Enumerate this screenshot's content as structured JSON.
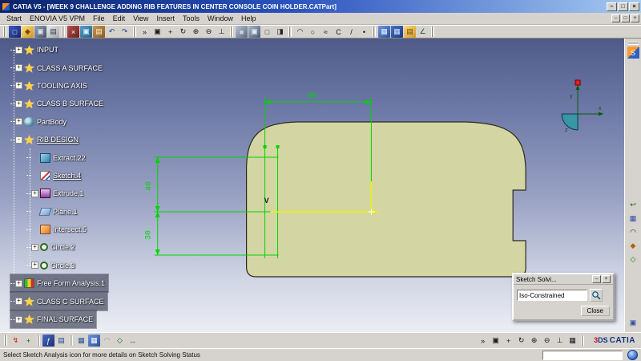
{
  "colors": {
    "titlebar_blue": "#0a246a",
    "viewport_top": "#4f5a88",
    "viewport_bottom": "#eceef5",
    "dim_green": "#00d400",
    "axis_yellow": "#f0f000",
    "surface_fill": "#d3d6a2"
  },
  "window": {
    "title": "CATIA V5 - [WEEK 9 CHALLENGE ADDING RIB FEATURES IN CENTER CONSOLE COIN HOLDER.CATPart]",
    "min": "–",
    "max": "□",
    "close": "×"
  },
  "mdi": {
    "min": "–",
    "restore": "□",
    "close": "×"
  },
  "menubar": {
    "items": [
      {
        "name": "menu-start",
        "label": "Start"
      },
      {
        "name": "menu-enovia",
        "label": "ENOVIA V5 VPM"
      },
      {
        "name": "menu-file",
        "label": "File"
      },
      {
        "name": "menu-edit",
        "label": "Edit"
      },
      {
        "name": "menu-view",
        "label": "View"
      },
      {
        "name": "menu-insert",
        "label": "Insert"
      },
      {
        "name": "menu-tools",
        "label": "Tools"
      },
      {
        "name": "menu-window",
        "label": "Window"
      },
      {
        "name": "menu-help",
        "label": "Help"
      }
    ]
  },
  "toolbar_top": {
    "icons": [
      {
        "cls": "grip"
      },
      {
        "name": "new-document-icon",
        "glyph": "□",
        "fg": "#ffffff",
        "bg": "linear-gradient(135deg,#3b5bbf,#14246e)"
      },
      {
        "name": "open-document-icon",
        "glyph": "◆",
        "fg": "#7a4a10",
        "bg": "linear-gradient(135deg,#ffe082,#cf9420)"
      },
      {
        "name": "save-icon",
        "glyph": "▣",
        "fg": "#dce6f0",
        "bg": "linear-gradient(135deg,#93a2b8,#46536a)"
      },
      {
        "name": "print-icon",
        "glyph": "▤",
        "fg": "#30383f",
        "bg": "linear-gradient(135deg,#e9ebee,#a2a9b2)"
      },
      {
        "cls": "grip"
      },
      {
        "name": "cut-icon",
        "glyph": "×",
        "fg": "#ffffff",
        "bg": "linear-gradient(135deg,#b05050,#6e2020)"
      },
      {
        "name": "copy-icon",
        "glyph": "▣",
        "fg": "#e8f4ff",
        "bg": "linear-gradient(135deg,#58a0c8,#20618c)"
      },
      {
        "name": "paste-icon",
        "glyph": "▤",
        "fg": "#fff2d0",
        "bg": "linear-gradient(135deg,#c89858,#8a5a20)"
      },
      {
        "name": "undo-icon",
        "glyph": "↶",
        "fg": "#174a8c"
      },
      {
        "name": "redo-icon",
        "glyph": "↷",
        "fg": "#174a8c"
      },
      {
        "cls": "grip"
      },
      {
        "name": "fly-mode-icon",
        "glyph": "»",
        "fg": "#10141c"
      },
      {
        "name": "fit-all-in-icon",
        "glyph": "▣",
        "fg": "#10141c"
      },
      {
        "name": "pan-icon",
        "glyph": "+",
        "fg": "#10141c"
      },
      {
        "name": "rotate-icon",
        "glyph": "↻",
        "fg": "#10141c"
      },
      {
        "name": "zoom-in-icon",
        "glyph": "⊕",
        "fg": "#10141c"
      },
      {
        "name": "zoom-out-icon",
        "glyph": "⊖",
        "fg": "#10141c"
      },
      {
        "name": "normal-view-icon",
        "glyph": "⊥",
        "fg": "#10141c"
      },
      {
        "cls": "grip"
      },
      {
        "name": "shaded-view-icon",
        "glyph": "■",
        "fg": "#c8d4e4",
        "bg": "linear-gradient(135deg,#b8c4d4,#5a6a80)"
      },
      {
        "name": "shaded-edges-view-icon",
        "glyph": "▣",
        "fg": "#e8eef6",
        "bg": "linear-gradient(135deg,#a8b8cc,#4a5a70)"
      },
      {
        "name": "wireframe-view-icon",
        "glyph": "□",
        "fg": "#222831"
      },
      {
        "name": "hidden-line-view-icon",
        "glyph": "◨",
        "fg": "#222831"
      },
      {
        "cls": "grip"
      },
      {
        "name": "profile-tool-icon",
        "glyph": "◠",
        "fg": "#101418"
      },
      {
        "name": "circle-tool-icon",
        "glyph": "○",
        "fg": "#101418"
      },
      {
        "name": "spline-tool-icon",
        "glyph": "≈",
        "fg": "#101418"
      },
      {
        "name": "conic-tool-icon",
        "glyph": "C",
        "fg": "#101418"
      },
      {
        "name": "line-tool-icon",
        "glyph": "/",
        "fg": "#101418"
      },
      {
        "name": "point-tool-icon",
        "glyph": "•",
        "fg": "#101418"
      },
      {
        "cls": "grip"
      },
      {
        "name": "grid-icon",
        "glyph": "▦",
        "fg": "#eaf2ff",
        "bg": "linear-gradient(135deg,#6e96dc,#2a4f9e)"
      },
      {
        "name": "snap-to-grid-icon",
        "glyph": "▦",
        "fg": "#cfe0ff",
        "bg": "linear-gradient(135deg,#4a74c4,#183a80)"
      },
      {
        "name": "catalog-icon",
        "glyph": "▤",
        "fg": "#6e4a10",
        "bg": "linear-gradient(135deg,#ffd878,#cf9830)"
      },
      {
        "name": "measure-icon",
        "glyph": "∠",
        "fg": "#155a15"
      },
      {
        "cls": "grip"
      }
    ]
  },
  "tree": {
    "items": [
      {
        "name": "tree-item-input",
        "label": "INPUT",
        "expand": "+",
        "icon": "geoset",
        "ml": "0px"
      },
      {
        "name": "tree-item-class-a-surface",
        "label": "CLASS A SURFACE",
        "expand": "+",
        "icon": "geoset",
        "ml": "0px"
      },
      {
        "name": "tree-item-tooling-axis",
        "label": "TOOLING AXIS",
        "expand": "+",
        "icon": "geoset",
        "ml": "0px"
      },
      {
        "name": "tree-item-class-b-surface",
        "label": "CLASS B SURFACE",
        "expand": "+",
        "icon": "geoset",
        "ml": "0px"
      },
      {
        "name": "tree-item-partbody",
        "label": "PartBody",
        "expand": "+",
        "icon": "partbody",
        "ml": "0px"
      },
      {
        "name": "tree-item-rib-design",
        "label": "RIB DESIGN",
        "expand": "-",
        "icon": "geoset",
        "ml": "0px",
        "cls": "u"
      },
      {
        "name": "tree-item-extract-22",
        "label": "Extract.22",
        "icon": "extract",
        "ml": "20px"
      },
      {
        "name": "tree-item-sketch-4",
        "label": "Sketch.4",
        "icon": "sketch",
        "ml": "20px",
        "cls": "u"
      },
      {
        "name": "tree-item-extrude-1",
        "label": "Extrude.1",
        "expand": "+",
        "icon": "extrude",
        "ml": "20px"
      },
      {
        "name": "tree-item-plane-1",
        "label": "Plane.1",
        "icon": "plane",
        "ml": "20px"
      },
      {
        "name": "tree-item-intersect-5",
        "label": "Intersect.5",
        "icon": "intersect",
        "ml": "20px"
      },
      {
        "name": "tree-item-circle-2",
        "label": "Circle.2",
        "expand": "+",
        "icon": "circle",
        "ml": "20px"
      },
      {
        "name": "tree-item-circle-3",
        "label": "Circle.3",
        "expand": "+",
        "icon": "circle",
        "ml": "20px"
      },
      {
        "name": "tree-item-free-form-analysis-1",
        "label": "Free Form Analysis.1",
        "expand": "+",
        "icon": "analysis",
        "ml": "0px",
        "cls": "boxed"
      },
      {
        "name": "tree-item-class-c-surface",
        "label": "CLASS C SURFACE",
        "expand": "+",
        "icon": "geoset",
        "ml": "0px",
        "cls": "boxed"
      },
      {
        "name": "tree-item-final-surface",
        "label": "FINAL SURFACE",
        "expand": "+",
        "icon": "geoset",
        "ml": "0px",
        "cls": "boxed"
      }
    ]
  },
  "sketch": {
    "dim_width": "80",
    "dim_upper": "40",
    "dim_lower": "30",
    "v_marker": "V"
  },
  "compass": {
    "x": "x",
    "y": "y",
    "z": "z"
  },
  "dialog": {
    "title": "Sketch Solvi...",
    "min": "–",
    "close_x": "×",
    "status_value": "Iso-Constrained",
    "close_label": "Close"
  },
  "toolbar_bottom": {
    "icons": [
      {
        "cls": "grip"
      },
      {
        "name": "update-icon",
        "glyph": "↯",
        "fg": "#cc2200"
      },
      {
        "name": "axis-system-icon",
        "glyph": "+",
        "fg": "#156015"
      },
      {
        "cls": "grip"
      },
      {
        "name": "knowledge-formula-icon",
        "glyph": "ƒ",
        "fg": "#ffffff",
        "bg": "linear-gradient(135deg,#4a6cc0,#1a2f74)"
      },
      {
        "name": "design-table-icon",
        "glyph": "▤",
        "fg": "#174a8c"
      },
      {
        "cls": "grip"
      },
      {
        "name": "sketch-grid-icon",
        "glyph": "▦",
        "fg": "#2a4f9e"
      },
      {
        "name": "snap-to-point-icon",
        "glyph": "▦",
        "fg": "#ffffff",
        "bg": "linear-gradient(135deg,#6e96dc,#2a4f9e)"
      },
      {
        "name": "construction-element-icon",
        "glyph": "◠",
        "fg": "#8a8f98"
      },
      {
        "name": "geometrical-constraints-icon",
        "glyph": "◇",
        "fg": "#156015"
      },
      {
        "name": "dimensional-constraints-icon",
        "glyph": "↔",
        "fg": "#156015"
      },
      {
        "cls": "space",
        "inter": false
      },
      {
        "name": "view-fly-icon",
        "glyph": "»",
        "fg": "#10141c"
      },
      {
        "name": "view-fit-all-icon",
        "glyph": "▣",
        "fg": "#10141c"
      },
      {
        "name": "view-pan-icon",
        "glyph": "+",
        "fg": "#10141c"
      },
      {
        "name": "view-rotate-icon",
        "glyph": "↻",
        "fg": "#10141c"
      },
      {
        "name": "view-zoom-in-icon",
        "glyph": "⊕",
        "fg": "#10141c"
      },
      {
        "name": "view-zoom-out-icon",
        "glyph": "⊖",
        "fg": "#10141c"
      },
      {
        "name": "view-normal-icon",
        "glyph": "⊥",
        "fg": "#10141c"
      },
      {
        "name": "view-multi-icon",
        "glyph": "▦",
        "fg": "#10141c"
      },
      {
        "cls": "grip"
      }
    ]
  },
  "right_toolbar": {
    "top": [
      {
        "name": "sketcher-workbench-icon",
        "glyph": "S",
        "fg": "#ffffff",
        "bg": "linear-gradient(135deg,#ff9830 50%,#3060c0 50%)"
      }
    ],
    "mid": [
      {
        "name": "exit-workbench-icon",
        "glyph": "↩",
        "fg": "#156015"
      },
      {
        "name": "sketch-tools-icon",
        "glyph": "▦",
        "fg": "#2a4f9e"
      },
      {
        "name": "profile-toolbar-icon",
        "glyph": "◠",
        "fg": "#101418"
      },
      {
        "name": "operation-toolbar-icon",
        "glyph": "◆",
        "fg": "#b06010"
      },
      {
        "name": "constraint-toolbar-icon",
        "glyph": "◇",
        "fg": "#0a7a0a"
      }
    ],
    "bottom": [
      {
        "name": "selection-filter-icon",
        "glyph": "▣",
        "fg": "#2a4f9e"
      }
    ]
  },
  "statusbar": {
    "message": "Select Sketch Analysis icon for more details on Sketch Solving Status",
    "power_input_value": ""
  },
  "logo": {
    "mark": "3DS",
    "text": "CATIA"
  }
}
